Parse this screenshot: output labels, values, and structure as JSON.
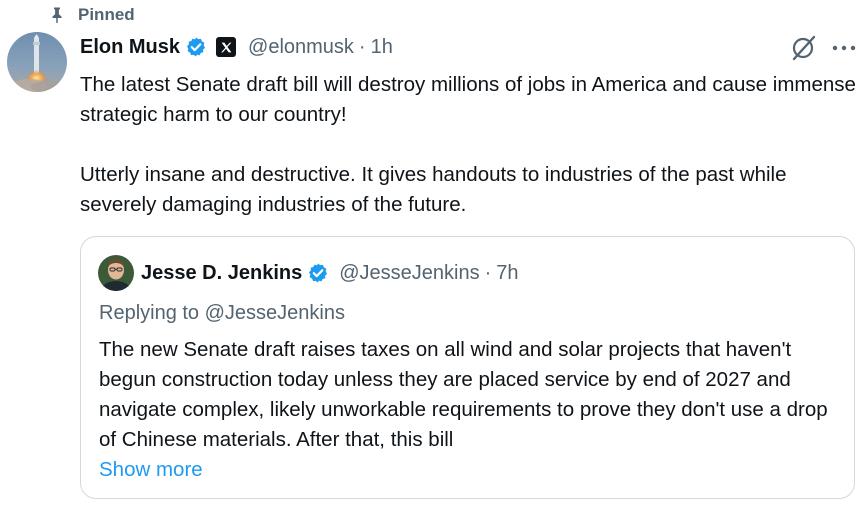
{
  "pinned": {
    "label": "Pinned"
  },
  "post": {
    "author_name": "Elon Musk",
    "handle": "@elonmusk",
    "separator": "·",
    "time": "1h",
    "paragraphs": [
      "The latest Senate draft bill will destroy millions of jobs in America and cause immense strategic harm to our country!",
      "Utterly insane and destructive. It gives handouts to industries of the past while severely damaging industries of the future."
    ]
  },
  "quote": {
    "author_name": "Jesse D. Jenkins",
    "handle": "@JesseJenkins",
    "separator": "·",
    "time": "7h",
    "replying_to": "Replying to @JesseJenkins",
    "text": "The new Senate draft raises taxes on all wind and solar projects that haven't begun construction today unless they are placed service by end of 2027 and navigate complex, likely unworkable requirements to prove they don't use a drop of Chinese materials. After that, this bill",
    "show_more_label": "Show more"
  },
  "colors": {
    "text_primary": "#0f1419",
    "text_secondary": "#536471",
    "link": "#1d9bf0",
    "verified": "#1d9bf0",
    "border": "#cfd9de"
  },
  "icons": {
    "pin": "pin-icon",
    "verified": "verified-badge-icon",
    "affiliate": "x-logo-icon",
    "grok": "grok-icon",
    "more": "more-horizontal-icon"
  }
}
